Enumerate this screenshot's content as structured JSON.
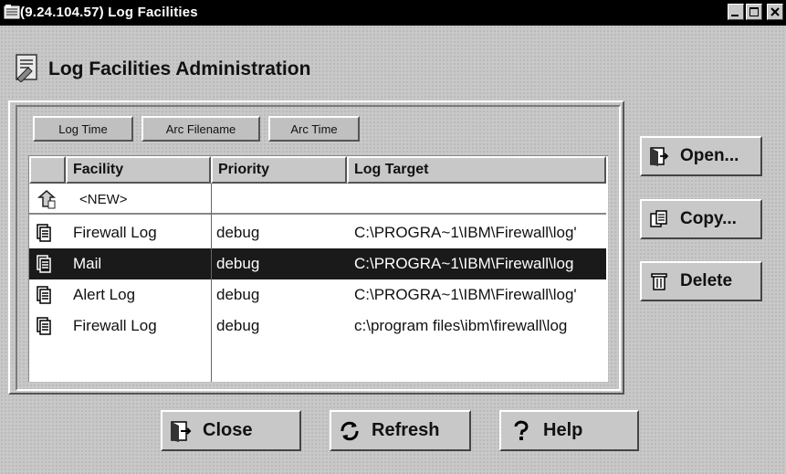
{
  "window": {
    "title": "(9.24.104.57) Log Facilities"
  },
  "header": {
    "title": "Log Facilities Administration"
  },
  "sort_buttons": [
    "Log Time",
    "Arc Filename",
    "Arc Time"
  ],
  "table": {
    "columns": [
      "Facility",
      "Priority",
      "Log Target"
    ],
    "new_row_label": "<NEW>",
    "rows": [
      {
        "facility": "Firewall Log",
        "priority": "debug",
        "target": "C:\\PROGRA~1\\IBM\\Firewall\\log'"
      },
      {
        "facility": "Mail",
        "priority": "debug",
        "target": "C:\\PROGRA~1\\IBM\\Firewall\\log",
        "selected": true
      },
      {
        "facility": "Alert Log",
        "priority": "debug",
        "target": "C:\\PROGRA~1\\IBM\\Firewall\\log'"
      },
      {
        "facility": "Firewall Log",
        "priority": "debug",
        "target": "c:\\program files\\ibm\\firewall\\log"
      }
    ]
  },
  "side_buttons": {
    "open": "Open...",
    "copy": "Copy...",
    "delete": "Delete"
  },
  "bottom_buttons": {
    "close": "Close",
    "refresh": "Refresh",
    "help": "Help"
  }
}
